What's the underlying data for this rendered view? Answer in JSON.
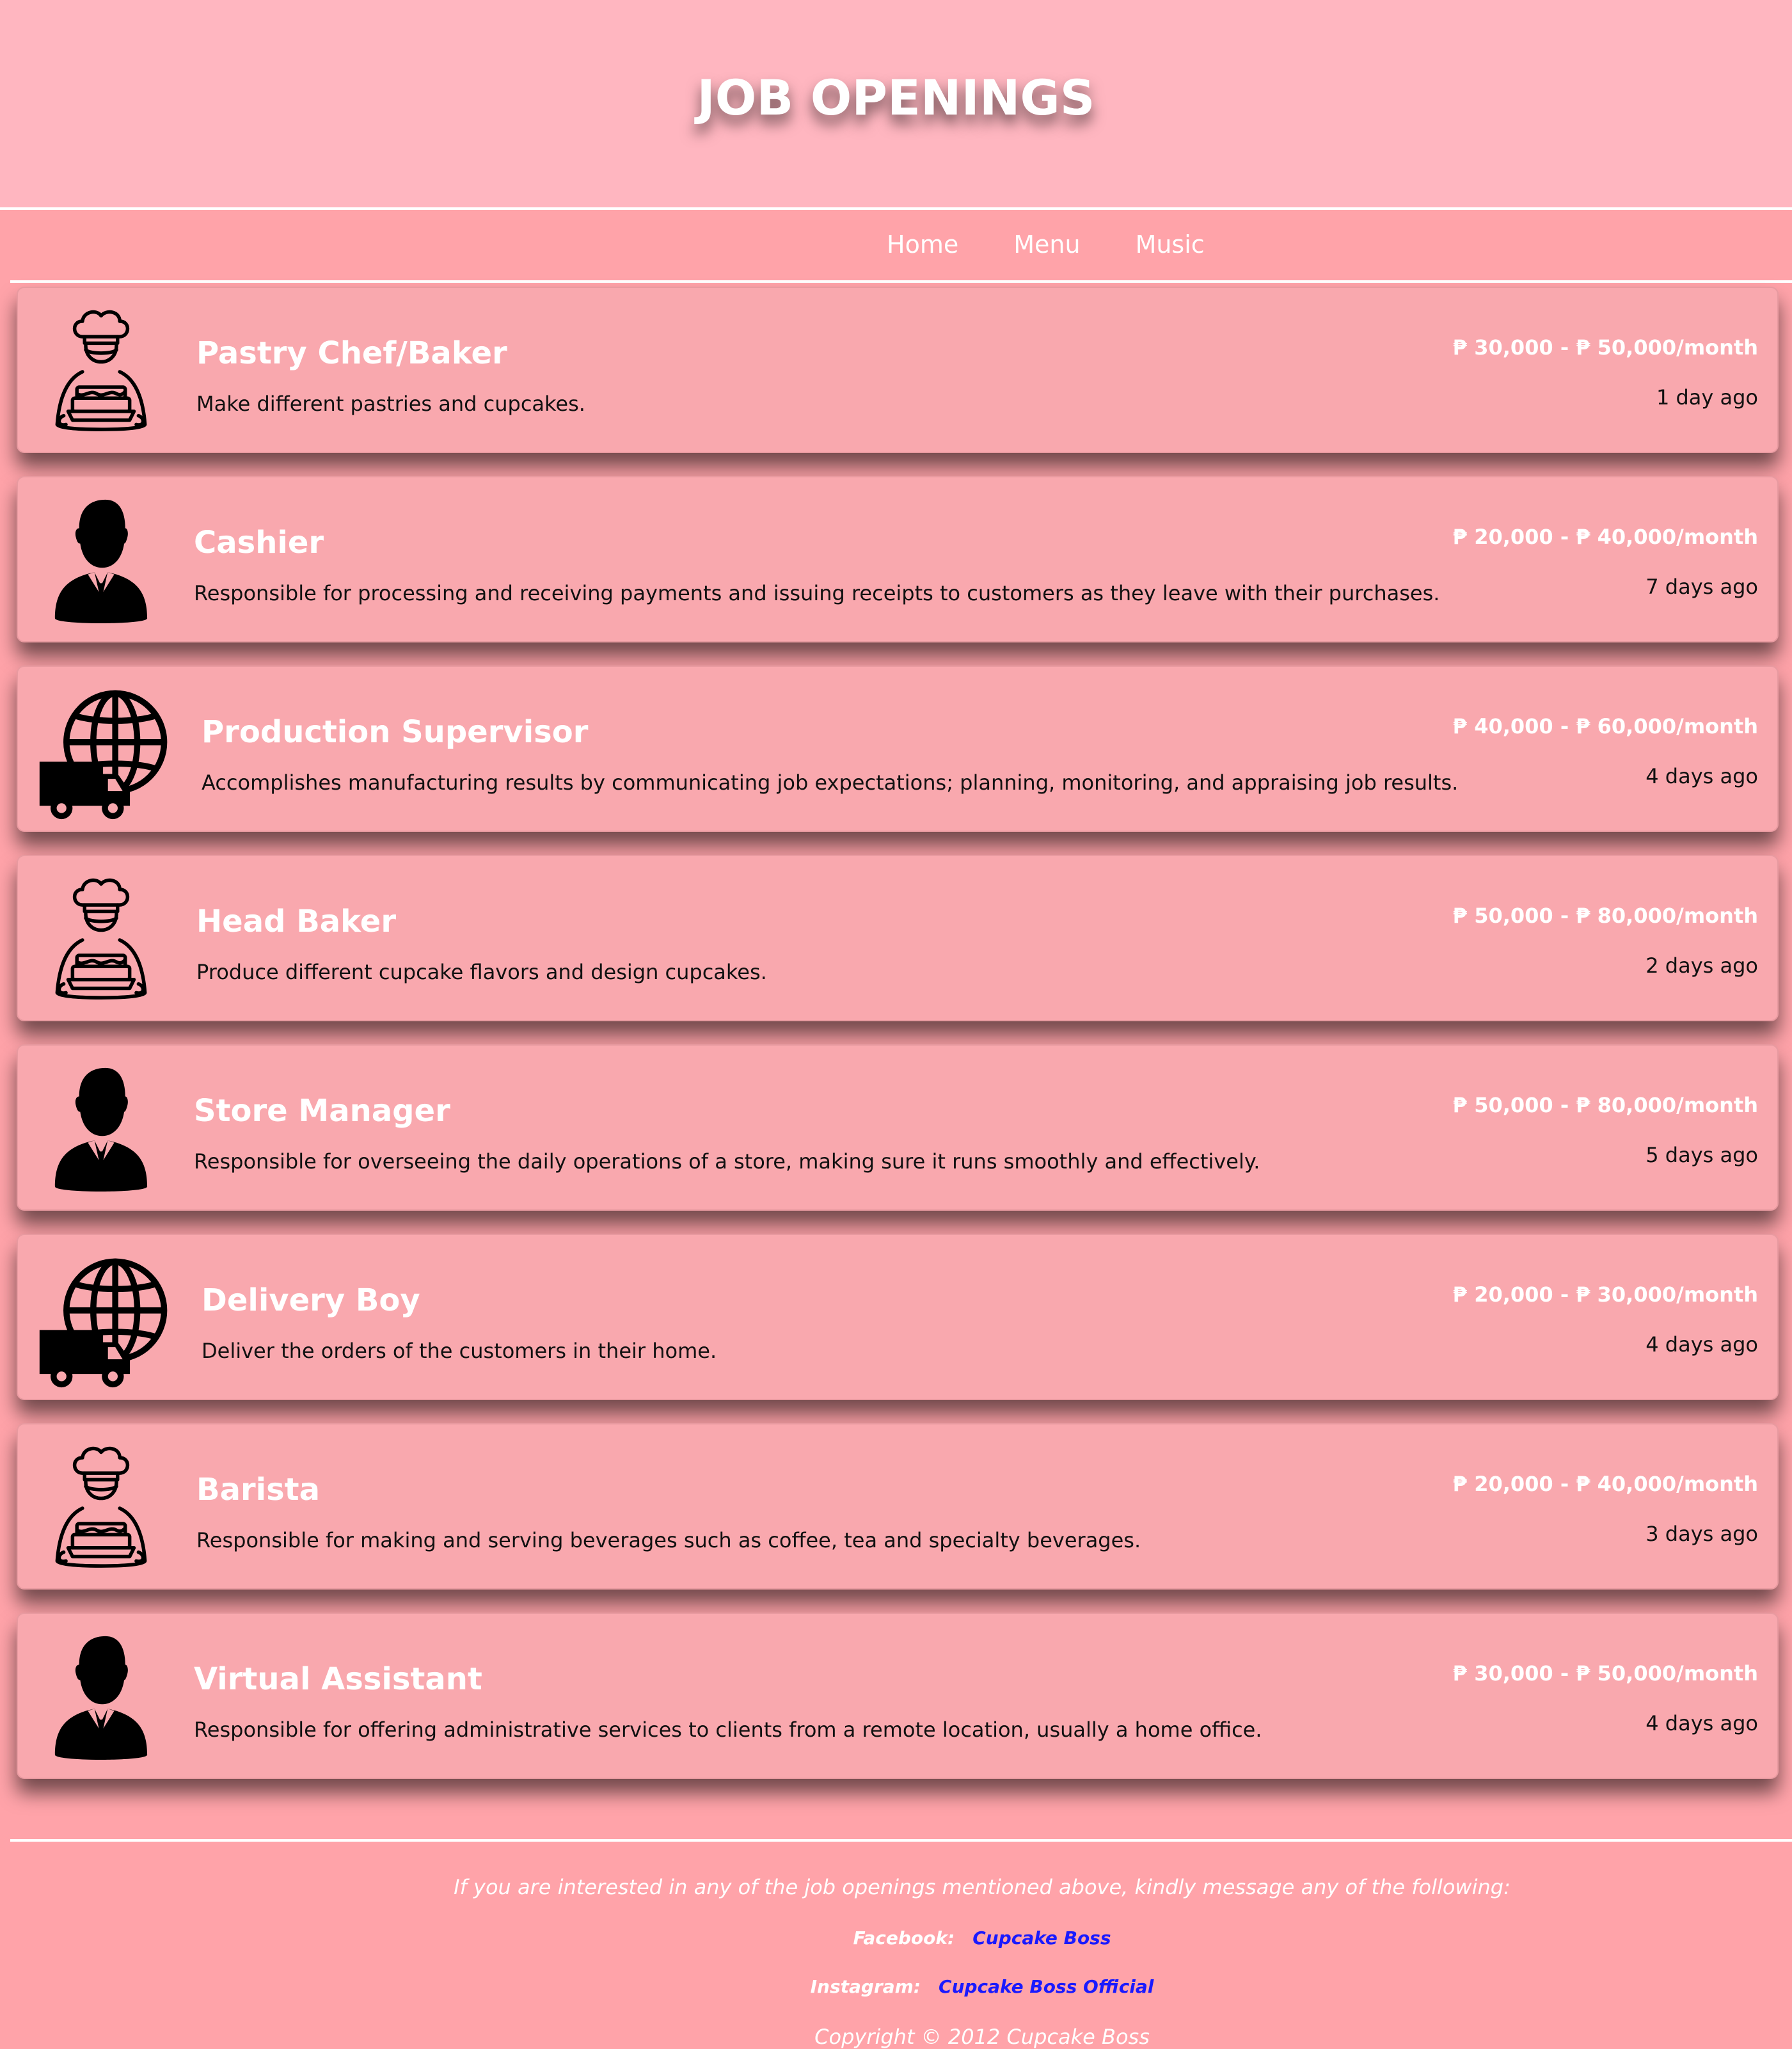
{
  "header": {
    "title": "JOB OPENINGS"
  },
  "nav": {
    "items": [
      "Home",
      "Menu",
      "Music"
    ]
  },
  "jobs": [
    {
      "icon": "chef-icon",
      "title": "Pastry Chef/Baker",
      "desc": "Make different pastries and cupcakes.",
      "salary": "₱ 30,000 - ₱ 50,000/month",
      "posted": "1 day ago"
    },
    {
      "icon": "businessman-icon",
      "title": "Cashier",
      "desc": "Responsible for processing and receiving payments and issuing receipts to customers as they leave with their purchases.",
      "salary": "₱ 20,000 - ₱ 40,000/month",
      "posted": "7 days ago"
    },
    {
      "icon": "global-delivery-icon",
      "title": "Production Supervisor",
      "desc": "Accomplishes manufacturing results by communicating job expectations; planning, monitoring, and appraising job results.",
      "salary": "₱ 40,000 - ₱ 60,000/month",
      "posted": "4 days ago"
    },
    {
      "icon": "chef-icon",
      "title": "Head Baker",
      "desc": "Produce different cupcake flavors and design cupcakes.",
      "salary": "₱ 50,000 - ₱ 80,000/month",
      "posted": "2 days ago"
    },
    {
      "icon": "businessman-icon",
      "title": "Store Manager",
      "desc": "Responsible for overseeing the daily operations of a store, making sure it runs smoothly and effectively.",
      "salary": "₱ 50,000 - ₱ 80,000/month",
      "posted": "5 days ago"
    },
    {
      "icon": "global-delivery-icon",
      "title": "Delivery Boy",
      "desc": "Deliver the orders of the customers in their home.",
      "salary": "₱ 20,000 - ₱ 30,000/month",
      "posted": "4 days ago"
    },
    {
      "icon": "chef-icon",
      "title": "Barista",
      "desc": "Responsible for making and serving beverages such as coffee, tea and specialty beverages.",
      "salary": "₱ 20,000 - ₱ 40,000/month",
      "posted": "3 days ago"
    },
    {
      "icon": "businessman-icon",
      "title": "Virtual Assistant",
      "desc": "Responsible for offering administrative services to clients from a remote location, usually a home office.",
      "salary": "₱ 30,000 - ₱ 50,000/month",
      "posted": "4 days ago"
    }
  ],
  "footer": {
    "note": "If you are interested in any of the job openings mentioned above, kindly message any of the following:",
    "facebook_label": "Facebook:",
    "facebook_link": "Cupcake Boss",
    "instagram_label": "Instagram:",
    "instagram_link": "Cupcake Boss Official",
    "copyright": "Copyright © 2012 Cupcake Boss"
  }
}
